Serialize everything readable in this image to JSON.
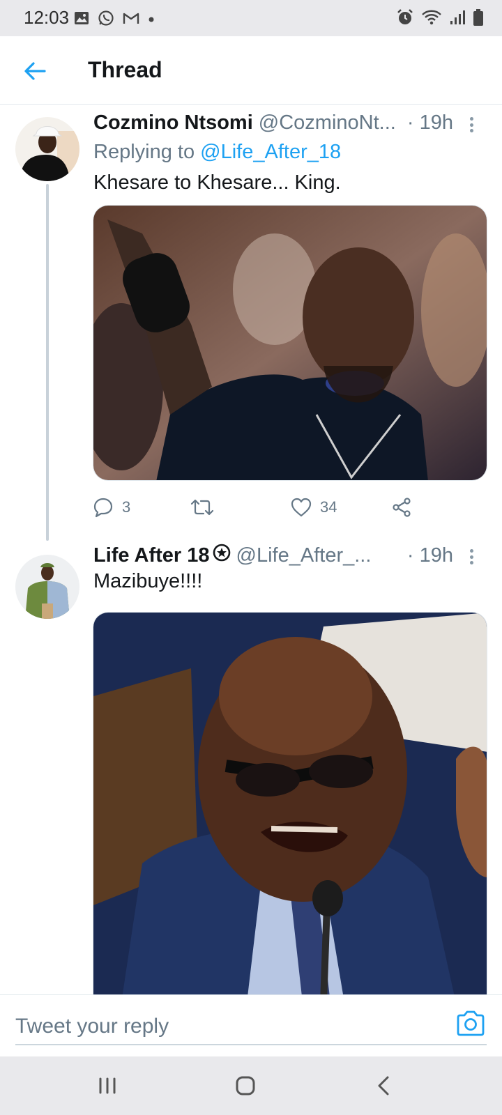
{
  "status_bar": {
    "time": "12:03",
    "left_icons": [
      "gallery-icon",
      "whatsapp-icon",
      "gmail-icon",
      "dot-icon"
    ],
    "right_icons": [
      "alarm-icon",
      "wifi-icon",
      "signal-icon",
      "battery-icon"
    ]
  },
  "header": {
    "title": "Thread"
  },
  "tweets": [
    {
      "display_name": "Cozmino Ntsomi",
      "handle": "@CozminoNt...",
      "time": "· 19h",
      "replying_prefix": "Replying to ",
      "replying_to": "@Life_After_18",
      "text": "Khesare to Khesare... King.",
      "media_colors": [
        "#3a2a22",
        "#0d1a2e",
        "#d8b39a"
      ],
      "actions": {
        "reply_count": "3",
        "retweet_count": "",
        "like_count": "34"
      }
    },
    {
      "display_name": "Life After 18",
      "handle": "@Life_After_...",
      "time": "· 19h",
      "text": "Mazibuye!!!!",
      "verified": true,
      "media_colors": [
        "#1b2a52",
        "#4a3022",
        "#d9d4cc"
      ]
    }
  ],
  "reply_bar": {
    "placeholder": "Tweet your reply"
  },
  "colors": {
    "accent": "#1da1f2",
    "secondary_text": "#657786",
    "thread_line": "#c8d1d9"
  }
}
